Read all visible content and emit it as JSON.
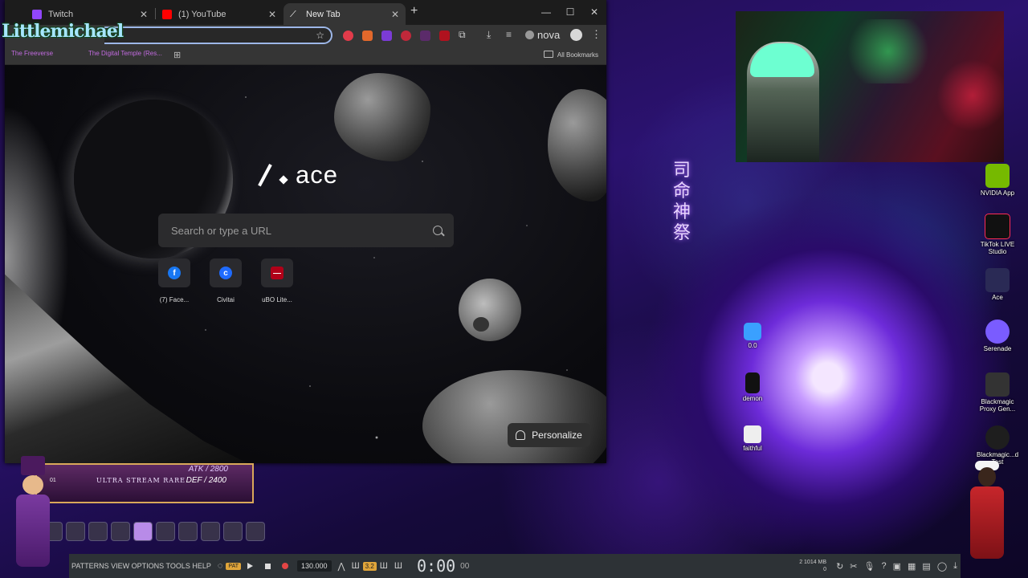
{
  "browser": {
    "tabs": [
      {
        "label": "Twitch",
        "fav_color": "#9146ff"
      },
      {
        "label": "(1) YouTube",
        "fav_color": "#ff0000"
      },
      {
        "label": "New Tab",
        "fav_color": "#ffffff"
      }
    ],
    "window_buttons": {
      "minimize": "—",
      "maximize": "☐",
      "close": "✕"
    },
    "new_tab_plus": "+",
    "toolbar": {
      "nova_label": "nova",
      "star": "☆",
      "menu": "⋮"
    },
    "bookmarks": {
      "items": [
        "The Freeverse",
        "The Digital Temple (Res..."
      ],
      "all_bookmarks": "All Bookmarks"
    },
    "newtab": {
      "logo_text": "ace",
      "search_placeholder": "Search or type a URL",
      "shortcuts": [
        {
          "label": "(7) Face...",
          "icon": "f",
          "color": "#1877f2"
        },
        {
          "label": "Civitai",
          "icon": "c",
          "color": "#1f6bff"
        },
        {
          "label": "uBO Lite...",
          "icon": "—",
          "color": "#b00018"
        }
      ],
      "personalize_label": "Personalize"
    }
  },
  "overlay": {
    "brand": "Littlemichael"
  },
  "desktop": {
    "kanji": "司命神祭",
    "icons": [
      {
        "label": "NVIDIA App",
        "color": "#76b900"
      },
      {
        "label": "TikTok LIVE Studio",
        "color": "#111111"
      },
      {
        "label": "Ace",
        "color": "#222244"
      },
      {
        "label": "Serenade",
        "color": "#7a5cff"
      },
      {
        "label": "Blackmagic Proxy Gen...",
        "color": "#333333"
      },
      {
        "label": "Blackmagic...d Test",
        "color": "#222222"
      },
      {
        "label": "0.0",
        "color": "#3aa0ff"
      },
      {
        "label": "demon",
        "color": "#111111"
      },
      {
        "label": "faithful",
        "color": "#eeeeee"
      }
    ]
  },
  "game_card": {
    "atk": "ATK / 2800",
    "def": "DEF / 2400",
    "rarity": "ULTRA STREAM RARE",
    "number": "01",
    "slot_count": 10,
    "selected_slot": 4
  },
  "daw": {
    "menus": "PATTERNS VIEW OPTIONS TOOLS HELP",
    "pat": "PAT",
    "tempo": "130.000",
    "badge": "3.2",
    "time": "0:00",
    "time_unit": "00",
    "mem_top": "2    1014 MB",
    "mem_bottom": "0"
  }
}
